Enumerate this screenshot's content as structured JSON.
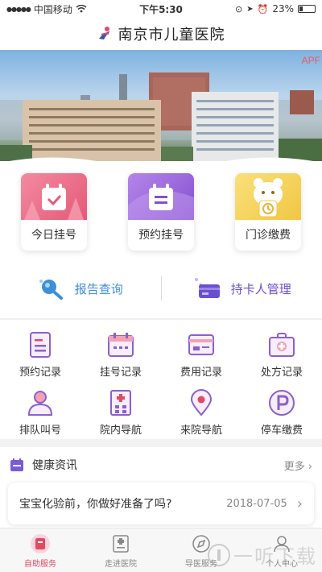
{
  "status_bar": {
    "carrier": "中国移动",
    "time": "下午5:30",
    "battery": "23%"
  },
  "header": {
    "title": "南京市儿童医院"
  },
  "banner": {
    "tag": "APF"
  },
  "quick_cards": [
    {
      "label": "今日挂号",
      "icon": "calendar-check-icon",
      "color": "#ee6d87"
    },
    {
      "label": "预约挂号",
      "icon": "appointment-icon",
      "color": "#9e64db"
    },
    {
      "label": "门诊缴费",
      "icon": "payment-bear-icon",
      "color": "#f5d45c"
    }
  ],
  "quick_links": [
    {
      "label": "报告查询",
      "icon": "search-icon",
      "color": "#3d8fd8"
    },
    {
      "label": "持卡人管理",
      "icon": "card-icon",
      "color": "#6a4fcf"
    }
  ],
  "grid": [
    {
      "label": "预约记录",
      "icon": "document-icon"
    },
    {
      "label": "挂号记录",
      "icon": "calendar-icon"
    },
    {
      "label": "费用记录",
      "icon": "bill-icon"
    },
    {
      "label": "处方记录",
      "icon": "medical-kit-icon"
    },
    {
      "label": "排队叫号",
      "icon": "queue-icon"
    },
    {
      "label": "院内导航",
      "icon": "building-icon"
    },
    {
      "label": "来院导航",
      "icon": "location-icon"
    },
    {
      "label": "停车缴费",
      "icon": "parking-icon"
    }
  ],
  "news": {
    "section_title": "健康资讯",
    "more_label": "更多",
    "items": [
      {
        "title": "宝宝化验前，你做好准备了吗?",
        "date": "2018-07-05"
      }
    ]
  },
  "tabbar": [
    {
      "label": "自助服务",
      "icon": "self-service-icon",
      "active": true
    },
    {
      "label": "走进医院",
      "icon": "hospital-info-icon",
      "active": false
    },
    {
      "label": "导医服务",
      "icon": "guide-icon",
      "active": false
    },
    {
      "label": "个人中心",
      "icon": "user-icon",
      "active": false
    }
  ],
  "watermark": {
    "text": "一听下载"
  },
  "colors": {
    "accent": "#e14a63",
    "purple": "#8b5fcf",
    "blue": "#3d8fd8"
  }
}
